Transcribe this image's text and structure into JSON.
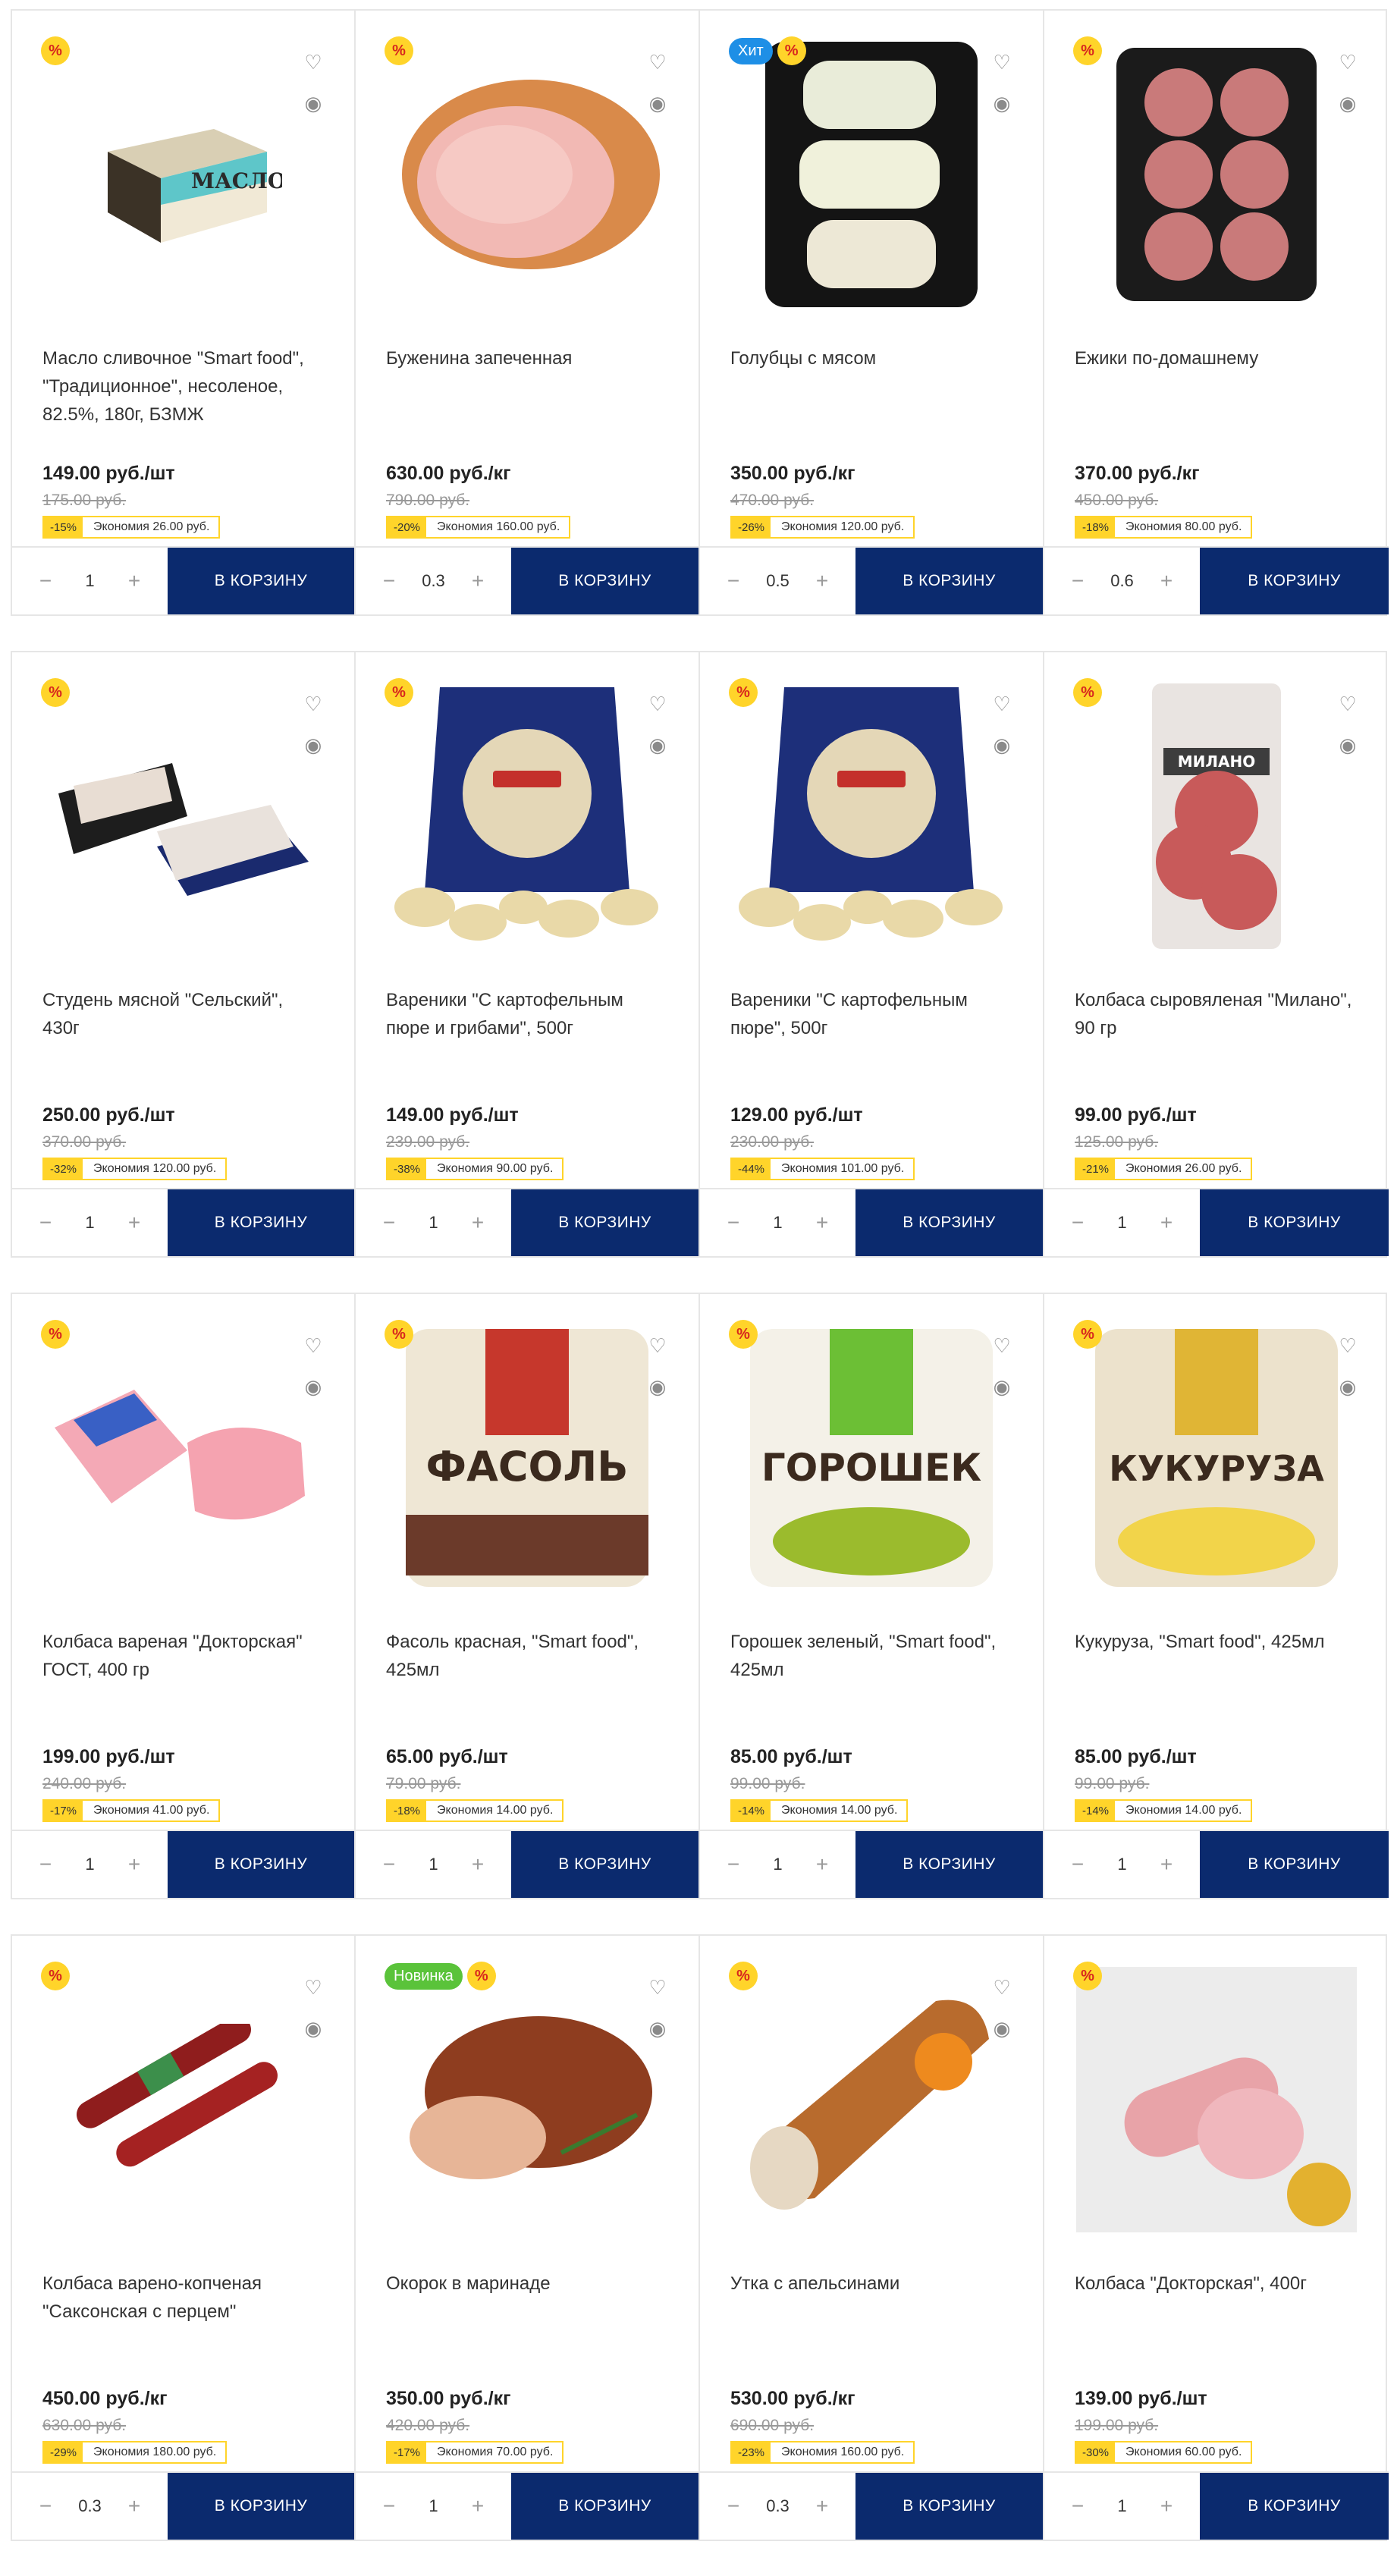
{
  "ui": {
    "add_to_cart": "В КОРЗИНУ",
    "minus": "−",
    "plus": "+",
    "favorite_icon": "♡",
    "view_icon": "◉"
  },
  "colors": {
    "accent_blue": "#0b2a6e",
    "discount_yellow": "#ffd42a",
    "hit_blue": "#1e8fe6",
    "new_green": "#5ac33a"
  },
  "rows": [
    {
      "cards": [
        {
          "badges": [
            "%"
          ],
          "title": "Масло сливочное \"Smart food\", \"Традиционное\", несоленое, 82.5%, 180г, БЗМЖ",
          "price": "149.00 руб./шт",
          "old_price": "175.00 руб.",
          "discount": "-15%",
          "economy": "Экономия 26.00 руб.",
          "qty": "1",
          "image": "butter"
        },
        {
          "badges": [
            "%"
          ],
          "title": "Буженина запеченная",
          "price": "630.00 руб./кг",
          "old_price": "790.00 руб.",
          "discount": "-20%",
          "economy": "Экономия 160.00 руб.",
          "qty": "0.3",
          "image": "ham"
        },
        {
          "badges": [
            "Хит",
            "%"
          ],
          "title": "Голубцы с мясом",
          "price": "350.00 руб./кг",
          "old_price": "470.00 руб.",
          "discount": "-26%",
          "economy": "Экономия 120.00 руб.",
          "qty": "0.5",
          "image": "cabbage"
        },
        {
          "badges": [
            "%"
          ],
          "title": "Ежики по-домашнему",
          "price": "370.00 руб./кг",
          "old_price": "450.00 руб.",
          "discount": "-18%",
          "economy": "Экономия 80.00 руб.",
          "qty": "0.6",
          "image": "meatballs"
        }
      ]
    },
    {
      "cards": [
        {
          "badges": [
            "%"
          ],
          "title": "Студень мясной \"Сельский\", 430г",
          "price": "250.00 руб./шт",
          "old_price": "370.00 руб.",
          "discount": "-32%",
          "economy": "Экономия 120.00 руб.",
          "qty": "1",
          "image": "jelly"
        },
        {
          "badges": [
            "%"
          ],
          "title": "Вареники \"С картофельным пюре и грибами\", 500г",
          "price": "149.00 руб./шт",
          "old_price": "239.00 руб.",
          "discount": "-38%",
          "economy": "Экономия 90.00 руб.",
          "qty": "1",
          "image": "dumplings"
        },
        {
          "badges": [
            "%"
          ],
          "title": "Вареники \"С картофельным пюре\", 500г",
          "price": "129.00 руб./шт",
          "old_price": "230.00 руб.",
          "discount": "-44%",
          "economy": "Экономия 101.00 руб.",
          "qty": "1",
          "image": "dumplings"
        },
        {
          "badges": [
            "%"
          ],
          "title": "Колбаса сыровяленая \"Милано\", 90 гр",
          "price": "99.00 руб./шт",
          "old_price": "125.00 руб.",
          "discount": "-21%",
          "economy": "Экономия 26.00 руб.",
          "qty": "1",
          "image": "salami"
        }
      ]
    },
    {
      "cards": [
        {
          "badges": [
            "%"
          ],
          "title": "Колбаса вареная \"Докторская\" ГОСТ, 400 гр",
          "price": "199.00 руб./шт",
          "old_price": "240.00 руб.",
          "discount": "-17%",
          "economy": "Экономия 41.00 руб.",
          "qty": "1",
          "image": "doctor"
        },
        {
          "badges": [
            "%"
          ],
          "title": "Фасоль красная, \"Smart food\", 425мл",
          "price": "65.00 руб./шт",
          "old_price": "79.00 руб.",
          "discount": "-18%",
          "economy": "Экономия 14.00 руб.",
          "qty": "1",
          "image": "can-beans"
        },
        {
          "badges": [
            "%"
          ],
          "title": "Горошек зеленый, \"Smart food\", 425мл",
          "price": "85.00 руб./шт",
          "old_price": "99.00 руб.",
          "discount": "-14%",
          "economy": "Экономия 14.00 руб.",
          "qty": "1",
          "image": "can-peas"
        },
        {
          "badges": [
            "%"
          ],
          "title": "Кукуруза, \"Smart food\", 425мл",
          "price": "85.00 руб./шт",
          "old_price": "99.00 руб.",
          "discount": "-14%",
          "economy": "Экономия 14.00 руб.",
          "qty": "1",
          "image": "can-corn"
        }
      ]
    },
    {
      "cards": [
        {
          "badges": [
            "%"
          ],
          "title": "Колбаса варено-копченая \"Саксонская с перцем\"",
          "price": "450.00 руб./кг",
          "old_price": "630.00 руб.",
          "discount": "-29%",
          "economy": "Экономия 180.00 руб.",
          "qty": "0.3",
          "image": "sausage-sticks"
        },
        {
          "badges": [
            "Новинка",
            "%"
          ],
          "title": "Окорок в маринаде",
          "price": "350.00 руб./кг",
          "old_price": "420.00 руб.",
          "discount": "-17%",
          "economy": "Экономия 70.00 руб.",
          "qty": "1",
          "image": "roast"
        },
        {
          "badges": [
            "%"
          ],
          "title": "Утка с апельсинами",
          "price": "530.00 руб./кг",
          "old_price": "690.00 руб.",
          "discount": "-23%",
          "economy": "Экономия 160.00 руб.",
          "qty": "0.3",
          "image": "duck"
        },
        {
          "badges": [
            "%"
          ],
          "title": "Колбаса \"Докторская\", 400г",
          "price": "139.00 руб./шт",
          "old_price": "199.00 руб.",
          "discount": "-30%",
          "economy": "Экономия 60.00 руб.",
          "qty": "1",
          "image": "doctor-roll"
        }
      ]
    }
  ]
}
